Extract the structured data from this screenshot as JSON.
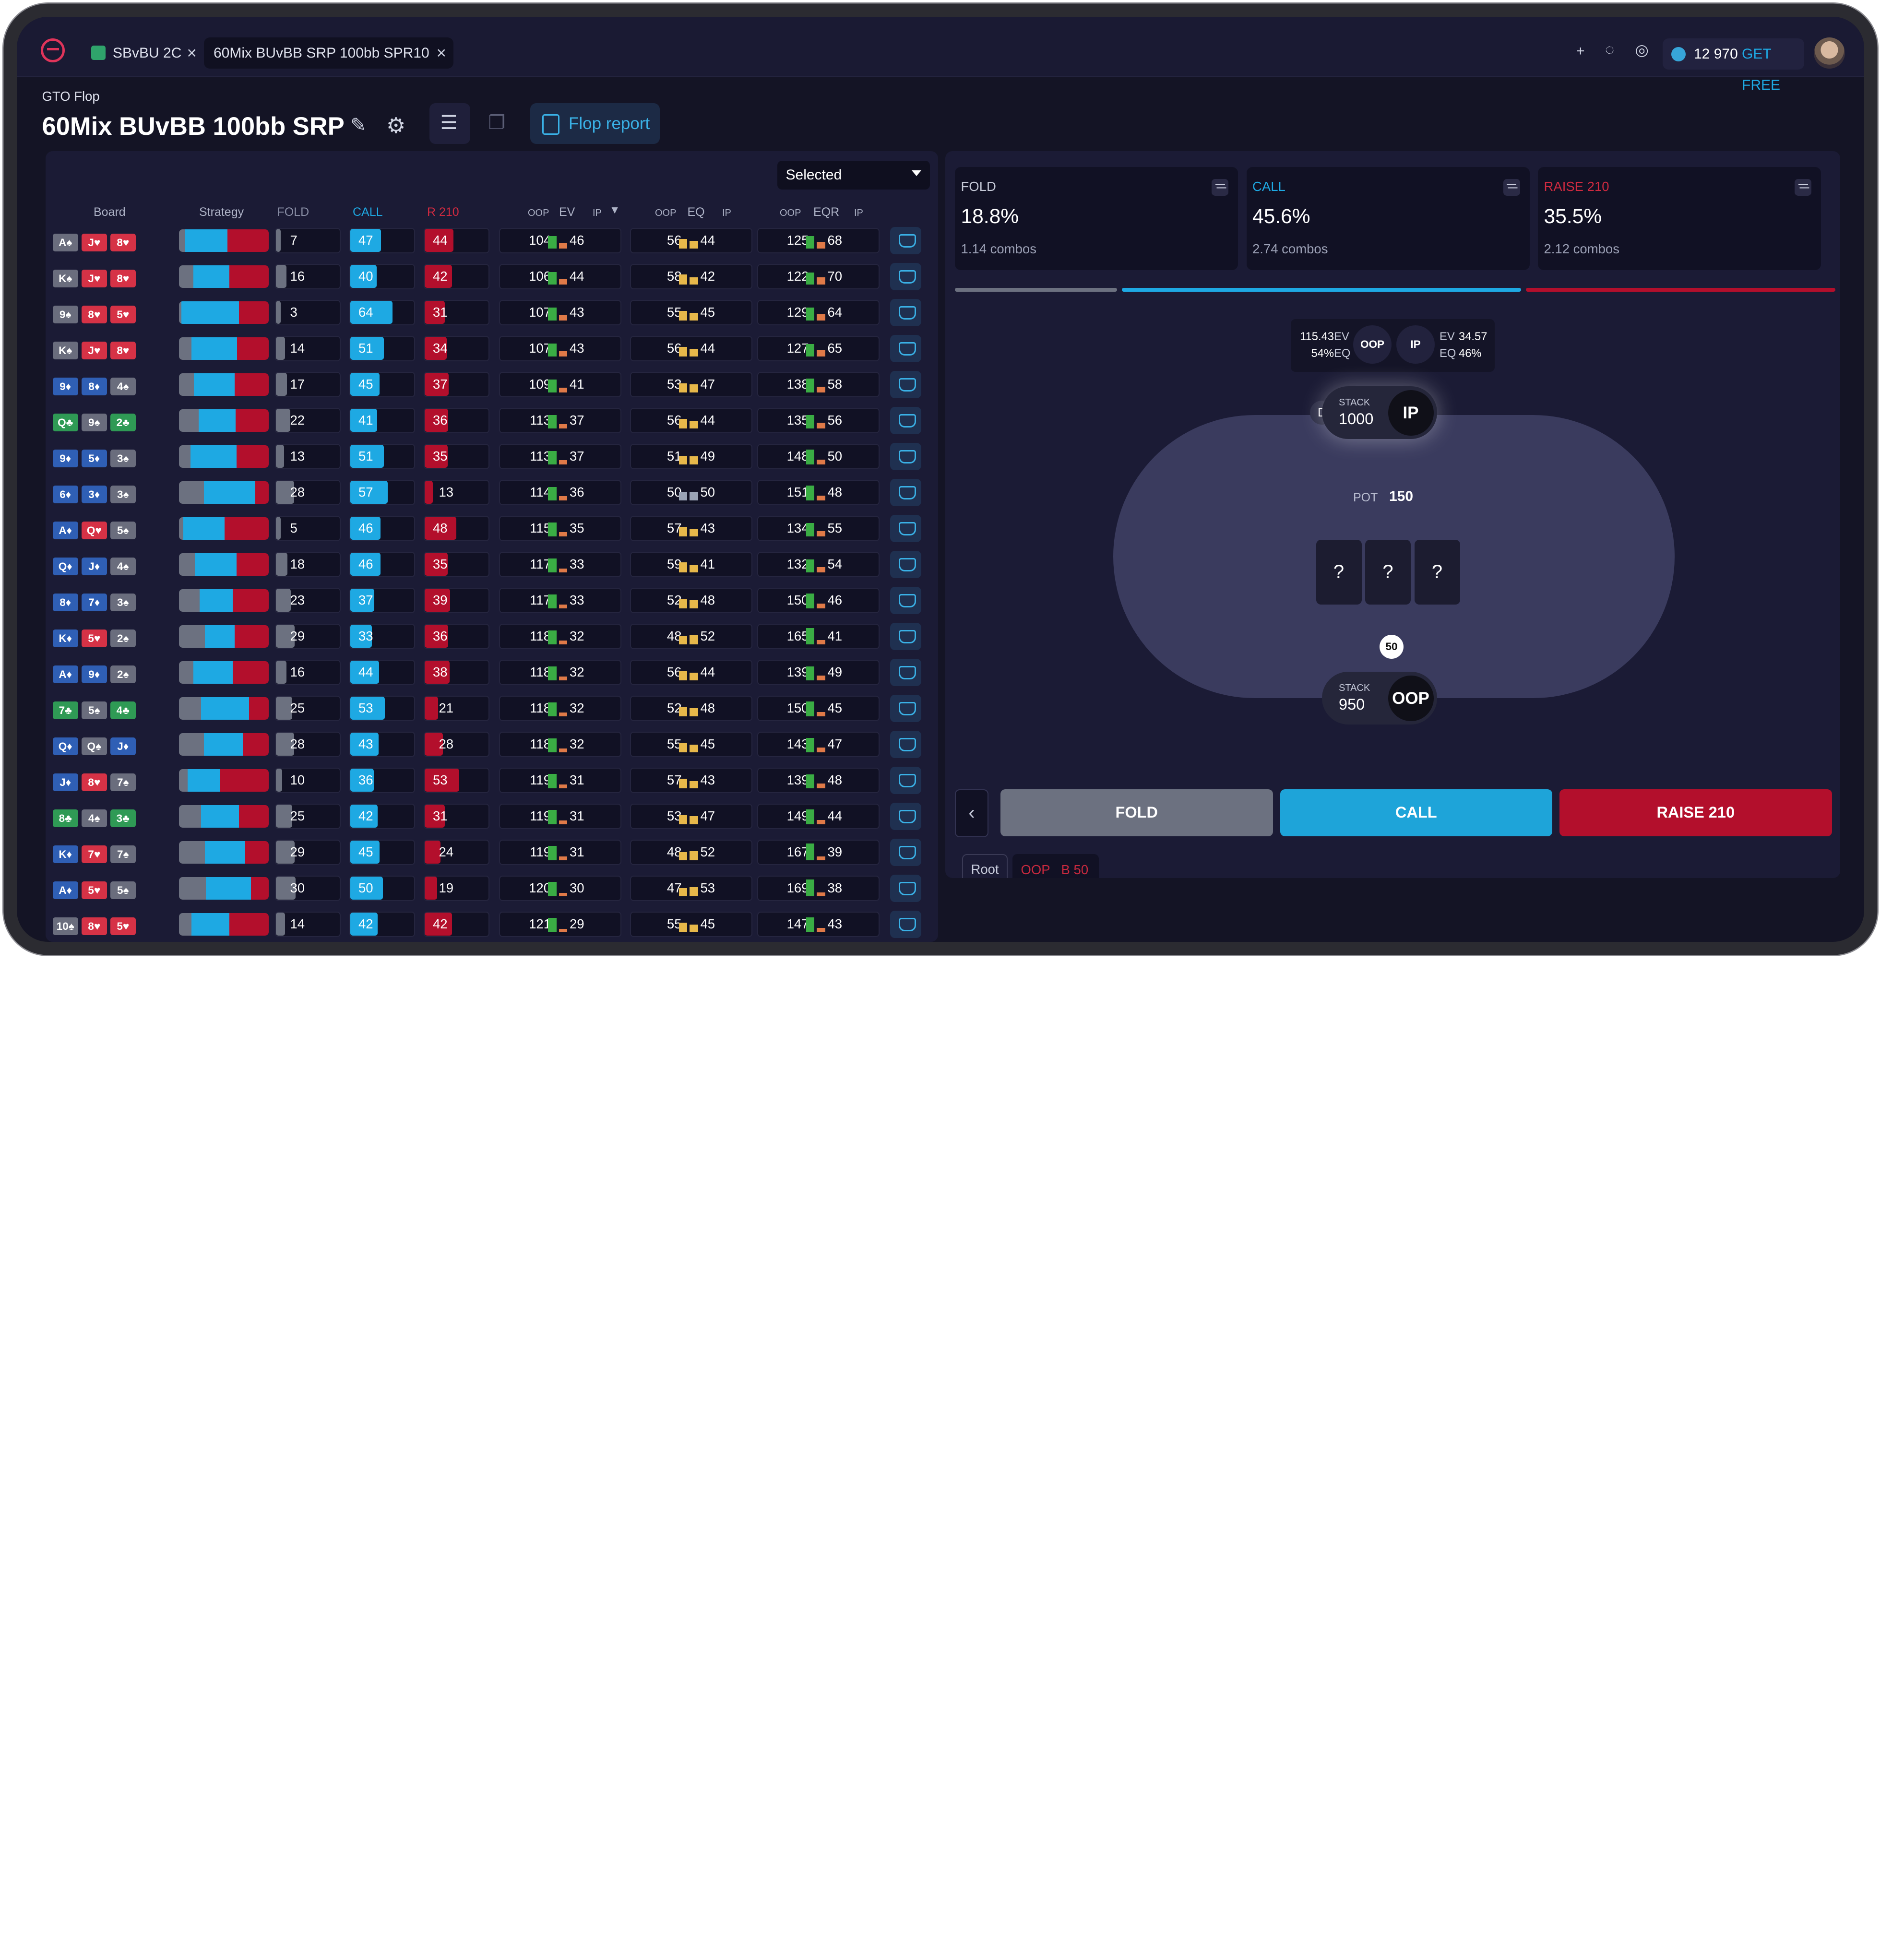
{
  "tabs": [
    {
      "label": "SBvBU 2C"
    },
    {
      "label": "60Mix BUvBB SRP 100bb SPR10"
    }
  ],
  "topbar": {
    "plus": "+",
    "credits": "12 970",
    "get_free": "GET FREE"
  },
  "breadcrumb": "GTO Flop",
  "title": "60Mix BUvBB 100bb SRP",
  "flop_report_label": "Flop report",
  "filter_select": "Selected",
  "headers": {
    "board": "Board",
    "strategy": "Strategy",
    "fold": "FOLD",
    "call": "CALL",
    "raise": "R 210",
    "oop": "OOP",
    "ev": "EV",
    "ip": "IP",
    "eq": "EQ",
    "eqr": "EQR"
  },
  "rows": [
    {
      "cards": [
        [
          "A",
          "s"
        ],
        [
          "J",
          "h"
        ],
        [
          "8",
          "h"
        ]
      ],
      "strat": [
        0.07,
        0.47,
        0.44
      ],
      "fold": "7",
      "call": "47",
      "raise": "44",
      "ev_oop": "104",
      "ev_ip": "46",
      "eq_oop": "56",
      "eq_ip": "44",
      "eqr_oop": "125",
      "eqr_ip": "68"
    },
    {
      "cards": [
        [
          "K",
          "s"
        ],
        [
          "J",
          "h"
        ],
        [
          "8",
          "h"
        ]
      ],
      "strat": [
        0.16,
        0.4,
        0.42
      ],
      "fold": "16",
      "call": "40",
      "raise": "42",
      "ev_oop": "106",
      "ev_ip": "44",
      "eq_oop": "58",
      "eq_ip": "42",
      "eqr_oop": "122",
      "eqr_ip": "70"
    },
    {
      "cards": [
        [
          "9",
          "s"
        ],
        [
          "8",
          "h"
        ],
        [
          "5",
          "h"
        ]
      ],
      "strat": [
        0.03,
        0.64,
        0.31
      ],
      "fold": "3",
      "call": "64",
      "raise": "31",
      "ev_oop": "107",
      "ev_ip": "43",
      "eq_oop": "55",
      "eq_ip": "45",
      "eqr_oop": "129",
      "eqr_ip": "64"
    },
    {
      "cards": [
        [
          "K",
          "s"
        ],
        [
          "J",
          "h"
        ],
        [
          "8",
          "h"
        ]
      ],
      "strat": [
        0.14,
        0.51,
        0.34
      ],
      "fold": "14",
      "call": "51",
      "raise": "34",
      "ev_oop": "107",
      "ev_ip": "43",
      "eq_oop": "56",
      "eq_ip": "44",
      "eqr_oop": "127",
      "eqr_ip": "65"
    },
    {
      "cards": [
        [
          "9",
          "d"
        ],
        [
          "8",
          "d"
        ],
        [
          "4",
          "s"
        ]
      ],
      "strat": [
        0.17,
        0.45,
        0.37
      ],
      "fold": "17",
      "call": "45",
      "raise": "37",
      "ev_oop": "109",
      "ev_ip": "41",
      "eq_oop": "53",
      "eq_ip": "47",
      "eqr_oop": "138",
      "eqr_ip": "58"
    },
    {
      "cards": [
        [
          "Q",
          "c"
        ],
        [
          "9",
          "s"
        ],
        [
          "2",
          "c"
        ]
      ],
      "strat": [
        0.22,
        0.41,
        0.36
      ],
      "fold": "22",
      "call": "41",
      "raise": "36",
      "ev_oop": "113",
      "ev_ip": "37",
      "eq_oop": "56",
      "eq_ip": "44",
      "eqr_oop": "135",
      "eqr_ip": "56"
    },
    {
      "cards": [
        [
          "9",
          "d"
        ],
        [
          "5",
          "d"
        ],
        [
          "3",
          "s"
        ]
      ],
      "strat": [
        0.13,
        0.51,
        0.35
      ],
      "fold": "13",
      "call": "51",
      "raise": "35",
      "ev_oop": "113",
      "ev_ip": "37",
      "eq_oop": "51",
      "eq_ip": "49",
      "eqr_oop": "148",
      "eqr_ip": "50"
    },
    {
      "cards": [
        [
          "6",
          "d"
        ],
        [
          "3",
          "d"
        ],
        [
          "3",
          "s"
        ]
      ],
      "strat": [
        0.28,
        0.57,
        0.13
      ],
      "fold": "28",
      "call": "57",
      "raise": "13",
      "ev_oop": "114",
      "ev_ip": "36",
      "eq_oop": "50",
      "eq_ip": "50",
      "eqr_oop": "151",
      "eqr_ip": "48"
    },
    {
      "cards": [
        [
          "A",
          "d"
        ],
        [
          "Q",
          "h"
        ],
        [
          "5",
          "s"
        ]
      ],
      "strat": [
        0.05,
        0.46,
        0.48
      ],
      "fold": "5",
      "call": "46",
      "raise": "48",
      "ev_oop": "115",
      "ev_ip": "35",
      "eq_oop": "57",
      "eq_ip": "43",
      "eqr_oop": "134",
      "eqr_ip": "55"
    },
    {
      "cards": [
        [
          "Q",
          "d"
        ],
        [
          "J",
          "d"
        ],
        [
          "4",
          "s"
        ]
      ],
      "strat": [
        0.18,
        0.46,
        0.35
      ],
      "fold": "18",
      "call": "46",
      "raise": "35",
      "ev_oop": "117",
      "ev_ip": "33",
      "eq_oop": "59",
      "eq_ip": "41",
      "eqr_oop": "132",
      "eqr_ip": "54"
    },
    {
      "cards": [
        [
          "8",
          "d"
        ],
        [
          "7",
          "d"
        ],
        [
          "3",
          "s"
        ]
      ],
      "strat": [
        0.23,
        0.37,
        0.39
      ],
      "fold": "23",
      "call": "37",
      "raise": "39",
      "ev_oop": "117",
      "ev_ip": "33",
      "eq_oop": "52",
      "eq_ip": "48",
      "eqr_oop": "150",
      "eqr_ip": "46"
    },
    {
      "cards": [
        [
          "K",
          "d"
        ],
        [
          "5",
          "h"
        ],
        [
          "2",
          "s"
        ]
      ],
      "strat": [
        0.29,
        0.33,
        0.36
      ],
      "fold": "29",
      "call": "33",
      "raise": "36",
      "ev_oop": "118",
      "ev_ip": "32",
      "eq_oop": "48",
      "eq_ip": "52",
      "eqr_oop": "165",
      "eqr_ip": "41"
    },
    {
      "cards": [
        [
          "A",
          "d"
        ],
        [
          "9",
          "d"
        ],
        [
          "2",
          "s"
        ]
      ],
      "strat": [
        0.16,
        0.44,
        0.38
      ],
      "fold": "16",
      "call": "44",
      "raise": "38",
      "ev_oop": "118",
      "ev_ip": "32",
      "eq_oop": "56",
      "eq_ip": "44",
      "eqr_oop": "139",
      "eqr_ip": "49"
    },
    {
      "cards": [
        [
          "7",
          "c"
        ],
        [
          "5",
          "s"
        ],
        [
          "4",
          "c"
        ]
      ],
      "strat": [
        0.25,
        0.53,
        0.21
      ],
      "fold": "25",
      "call": "53",
      "raise": "21",
      "ev_oop": "118",
      "ev_ip": "32",
      "eq_oop": "52",
      "eq_ip": "48",
      "eqr_oop": "150",
      "eqr_ip": "45"
    },
    {
      "cards": [
        [
          "Q",
          "d"
        ],
        [
          "Q",
          "s"
        ],
        [
          "J",
          "d"
        ]
      ],
      "strat": [
        0.28,
        0.43,
        0.28
      ],
      "fold": "28",
      "call": "43",
      "raise": "28",
      "ev_oop": "118",
      "ev_ip": "32",
      "eq_oop": "55",
      "eq_ip": "45",
      "eqr_oop": "143",
      "eqr_ip": "47"
    },
    {
      "cards": [
        [
          "J",
          "d"
        ],
        [
          "8",
          "h"
        ],
        [
          "7",
          "s"
        ]
      ],
      "strat": [
        0.1,
        0.36,
        0.53
      ],
      "fold": "10",
      "call": "36",
      "raise": "53",
      "ev_oop": "119",
      "ev_ip": "31",
      "eq_oop": "57",
      "eq_ip": "43",
      "eqr_oop": "139",
      "eqr_ip": "48"
    },
    {
      "cards": [
        [
          "8",
          "c"
        ],
        [
          "4",
          "s"
        ],
        [
          "3",
          "c"
        ]
      ],
      "strat": [
        0.25,
        0.42,
        0.31
      ],
      "fold": "25",
      "call": "42",
      "raise": "31",
      "ev_oop": "119",
      "ev_ip": "31",
      "eq_oop": "53",
      "eq_ip": "47",
      "eqr_oop": "149",
      "eqr_ip": "44"
    },
    {
      "cards": [
        [
          "K",
          "d"
        ],
        [
          "7",
          "h"
        ],
        [
          "7",
          "s"
        ]
      ],
      "strat": [
        0.29,
        0.45,
        0.24
      ],
      "fold": "29",
      "call": "45",
      "raise": "24",
      "ev_oop": "119",
      "ev_ip": "31",
      "eq_oop": "48",
      "eq_ip": "52",
      "eqr_oop": "167",
      "eqr_ip": "39"
    },
    {
      "cards": [
        [
          "A",
          "d"
        ],
        [
          "5",
          "h"
        ],
        [
          "5",
          "s"
        ]
      ],
      "strat": [
        0.3,
        0.5,
        0.19
      ],
      "fold": "30",
      "call": "50",
      "raise": "19",
      "ev_oop": "120",
      "ev_ip": "30",
      "eq_oop": "47",
      "eq_ip": "53",
      "eqr_oop": "169",
      "eqr_ip": "38"
    },
    {
      "cards": [
        [
          "10",
          "s"
        ],
        [
          "8",
          "h"
        ],
        [
          "5",
          "h"
        ]
      ],
      "strat": [
        0.14,
        0.42,
        0.42
      ],
      "fold": "14",
      "call": "42",
      "raise": "42",
      "ev_oop": "121",
      "ev_ip": "29",
      "eq_oop": "55",
      "eq_ip": "45",
      "eqr_oop": "147",
      "eqr_ip": "43"
    }
  ],
  "actions": [
    {
      "label": "FOLD",
      "pct": "18.8%",
      "combos": "1.14 combos",
      "color": "#c4c8d6",
      "bar": "#6c7180",
      "fraction": 0.188
    },
    {
      "label": "CALL",
      "pct": "45.6%",
      "combos": "2.74 combos",
      "color": "#1ea9e3",
      "bar": "#1ea9e3",
      "fraction": 0.456
    },
    {
      "label": "RAISE 210",
      "pct": "35.5%",
      "combos": "2.12 combos",
      "color": "#d02a40",
      "bar": "#b30f2c",
      "fraction": 0.355
    }
  ],
  "evpanel": {
    "oop_ev": "115.43",
    "oop_eq": "54%",
    "ev_lbl": "EV",
    "eq_lbl": "EQ",
    "oop": "OOP",
    "ip": "IP",
    "ip_ev": "34.57",
    "ip_eq": "46%"
  },
  "table": {
    "stack_lbl": "STACK",
    "ip_stack": "1000",
    "ip": "IP",
    "oop_stack": "950",
    "oop": "OOP",
    "dealer": "D",
    "pot_lbl": "POT",
    "pot": "150",
    "board": [
      "?",
      "?",
      "?"
    ],
    "bet_chip": "50"
  },
  "buttons": {
    "back": "‹",
    "fold": "FOLD",
    "call": "CALL",
    "raise": "RAISE 210"
  },
  "history": {
    "root": "Root",
    "oop": "OOP",
    "bet": "B 50"
  },
  "colors": {
    "fold": "#6c7180",
    "call": "#1ea9e3",
    "raise": "#b30f2c"
  }
}
